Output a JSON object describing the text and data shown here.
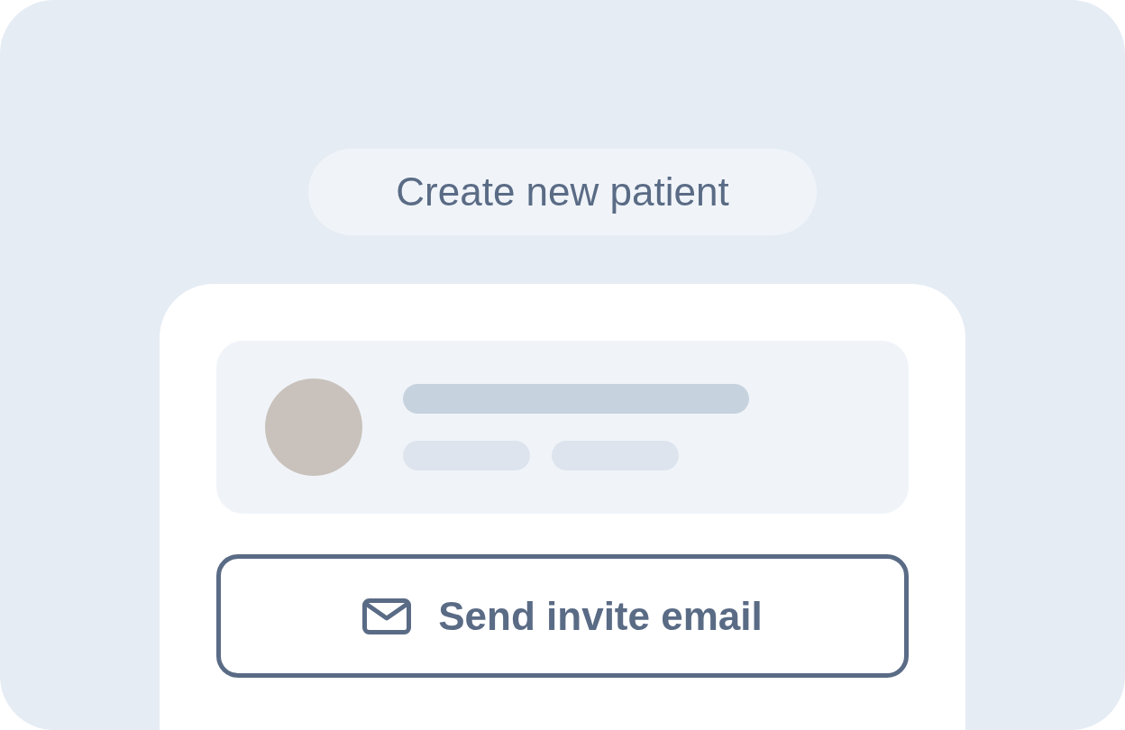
{
  "header_pill": {
    "label": "Create new patient"
  },
  "invite_button": {
    "label": "Send invite email"
  }
}
